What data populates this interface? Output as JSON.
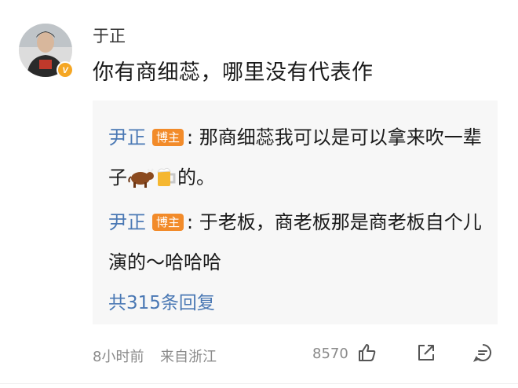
{
  "comment": {
    "username": "于正",
    "text": "你有商细蕊，哪里没有代表作",
    "avatar_icon": "user-avatar",
    "verified_icon": "verified-v-badge",
    "verified_color": "#f5a623"
  },
  "replies": [
    {
      "author": "尹正",
      "badge": "博主",
      "separator": ":",
      "text": "那商细蕊我可以是可以拿来吹一辈子",
      "emojis": [
        "ox-emoji",
        "beer-mug-emoji"
      ],
      "text_after": "的。"
    },
    {
      "author": "尹正",
      "badge": "博主",
      "separator": ":",
      "text": "于老板，商老板那是商老板自个儿演的～哈哈哈"
    }
  ],
  "more_replies": "共315条回复",
  "footer": {
    "time": "8小时前",
    "source": "来自浙江",
    "likes": "8570"
  },
  "colors": {
    "link": "#4a78b4",
    "badge": "#f28b2a",
    "reply_bg": "#f7f7f7"
  }
}
